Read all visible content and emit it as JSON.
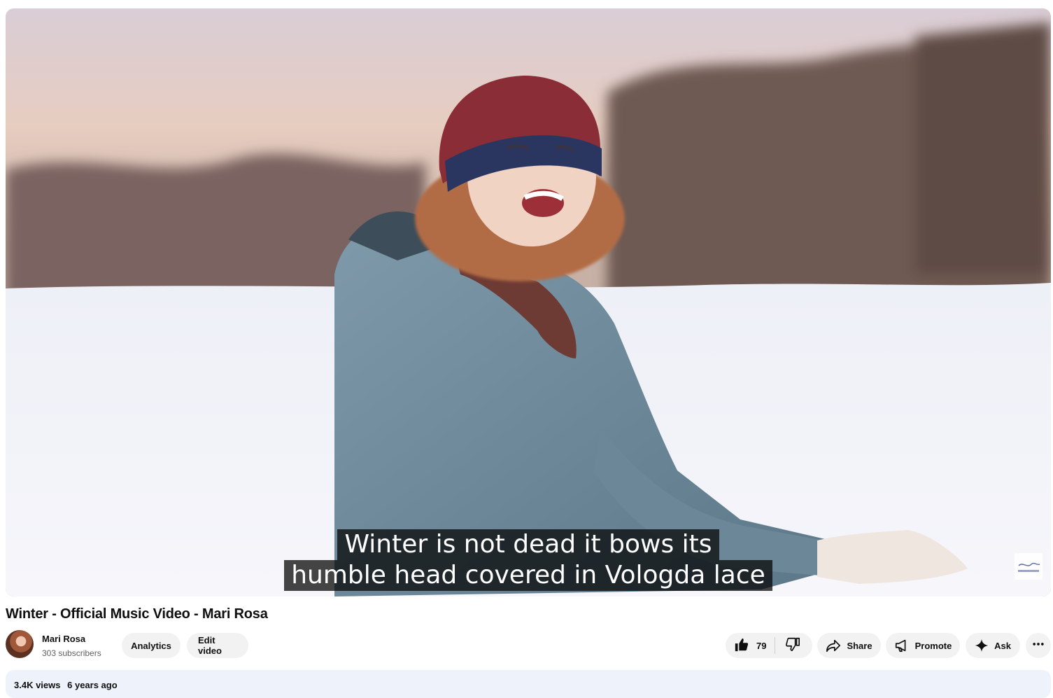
{
  "player": {
    "captions": [
      "Winter is not dead it bows its",
      "humble head covered in Vologda lace"
    ]
  },
  "video": {
    "title": "Winter - Official Music Video - Mari Rosa"
  },
  "channel": {
    "name": "Mari Rosa",
    "subscribers": "303 subscribers"
  },
  "buttons": {
    "analytics": "Analytics",
    "edit_video": "Edit video",
    "like_count": "79",
    "share": "Share",
    "promote": "Promote",
    "ask": "Ask"
  },
  "description": {
    "views": "3.4K views",
    "age": "6 years ago"
  },
  "icons": {
    "like": "thumbs-up-icon",
    "dislike": "thumbs-down-icon",
    "share": "share-arrow-icon",
    "promote": "megaphone-icon",
    "ask": "sparkle-icon",
    "more": "more-horizontal-icon"
  }
}
